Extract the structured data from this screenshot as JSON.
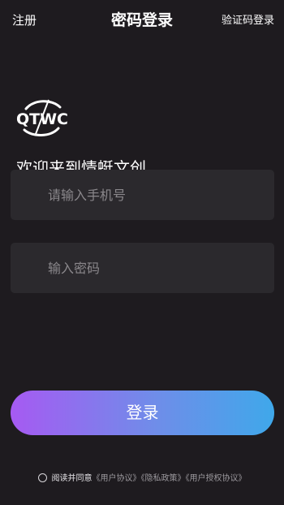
{
  "header": {
    "left_label": "注册",
    "title": "密码登录",
    "right_label": "验证码登录"
  },
  "logo": {
    "text": "QTWC"
  },
  "welcome_text": "欢迎来到情蜓文创",
  "phone_field": {
    "value": "",
    "placeholder": "请输入手机号"
  },
  "password_field": {
    "value": "",
    "placeholder": "输入密码"
  },
  "login_button": {
    "label": "登录"
  },
  "agreement": {
    "checked": false,
    "text": "阅读并同意",
    "links": [
      "《用户协议》",
      "《隐私政策》",
      "《用户授权协议》"
    ]
  },
  "colors": {
    "background": "#1e1b1f",
    "field_background": "#2b292d",
    "gradient_start": "#a65af2",
    "gradient_end": "#3fa8ea"
  }
}
